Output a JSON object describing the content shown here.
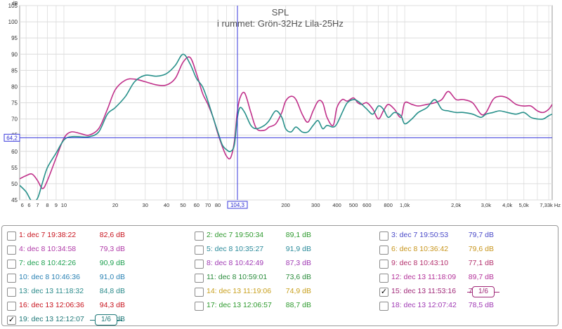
{
  "chart_data": {
    "type": "line",
    "title": "SPL",
    "subtitle": "i rummet: Grön-32Hz Lila-25Hz",
    "ylabel": "dB",
    "xscale": "log",
    "xlim": [
      5.5,
      7330
    ],
    "ylim": [
      45,
      105
    ],
    "grid": true,
    "y_ticks": [
      45,
      50,
      55,
      60,
      65,
      70,
      75,
      80,
      85,
      90,
      95,
      100,
      105
    ],
    "x_ticks": [
      {
        "v": 6,
        "label": "6"
      },
      {
        "v": 6,
        "label": "6"
      },
      {
        "v": 7,
        "label": "7"
      },
      {
        "v": 8,
        "label": "8"
      },
      {
        "v": 9,
        "label": "9"
      },
      {
        "v": 10,
        "label": "10"
      },
      {
        "v": 20,
        "label": "20"
      },
      {
        "v": 30,
        "label": "30"
      },
      {
        "v": 40,
        "label": "40"
      },
      {
        "v": 50,
        "label": "50"
      },
      {
        "v": 60,
        "label": "60"
      },
      {
        "v": 70,
        "label": "70"
      },
      {
        "v": 80,
        "label": "80"
      },
      {
        "v": 200,
        "label": "200"
      },
      {
        "v": 300,
        "label": "300"
      },
      {
        "v": 400,
        "label": "400"
      },
      {
        "v": 500,
        "label": "500"
      },
      {
        "v": 600,
        "label": "600"
      },
      {
        "v": 800,
        "label": "800"
      },
      {
        "v": 1000,
        "label": "1,0k"
      },
      {
        "v": 2000,
        "label": "2,0k"
      },
      {
        "v": 3000,
        "label": "3,0k"
      },
      {
        "v": 4000,
        "label": "4,0k"
      },
      {
        "v": 5000,
        "label": "5,0k"
      },
      {
        "v": 7330,
        "label": "7,33k Hz"
      }
    ],
    "cursor": {
      "x": 104.3,
      "x_label": "104,3",
      "y": 64.2,
      "y_label": "64,2"
    },
    "series": [
      {
        "color": "#c0308a",
        "x": [
          5.5,
          6,
          6.5,
          7,
          7.5,
          8,
          9,
          10,
          11,
          12.5,
          14,
          16,
          18,
          20,
          23,
          26,
          30,
          35,
          40,
          45,
          50,
          55,
          60,
          65,
          70,
          75,
          80,
          85,
          90,
          95,
          100,
          104,
          108,
          115,
          125,
          135,
          150,
          160,
          175,
          190,
          200,
          215,
          230,
          250,
          270,
          290,
          310,
          330,
          350,
          380,
          400,
          430,
          460,
          500,
          530,
          560,
          600,
          650,
          700,
          750,
          800,
          870,
          950,
          1000,
          1100,
          1200,
          1350,
          1500,
          1650,
          1800,
          2000,
          2200,
          2500,
          2800,
          3000,
          3300,
          3600,
          4000,
          4500,
          5000,
          5500,
          6000,
          6500,
          7000,
          7330
        ],
        "y": [
          51.5,
          52.5,
          53,
          51,
          48.5,
          51,
          58,
          64,
          66,
          65.5,
          65,
          67,
          73,
          79,
          82,
          82.3,
          81.5,
          80.5,
          80.5,
          82.5,
          87.5,
          89,
          84,
          78,
          74.5,
          70.5,
          65.5,
          61.5,
          58.5,
          58,
          63,
          72,
          76.5,
          78,
          72,
          67,
          66.5,
          67.5,
          68.5,
          72,
          75.5,
          77,
          76,
          71.5,
          69,
          72.5,
          75.5,
          75,
          70.5,
          68,
          73.5,
          76,
          75.5,
          76.5,
          75,
          74.5,
          75,
          73,
          70,
          72.5,
          74.5,
          73,
          70.5,
          75,
          74.5,
          74,
          74.5,
          75,
          76,
          78.5,
          76,
          76,
          75,
          71.5,
          72,
          76,
          77,
          76.5,
          74.5,
          74,
          74,
          72.5,
          72,
          73,
          74.5
        ]
      },
      {
        "color": "#27908a",
        "x": [
          5.5,
          6,
          6.5,
          7,
          7.5,
          8,
          9,
          10,
          11,
          12.5,
          14,
          16,
          18,
          20,
          23,
          26,
          30,
          35,
          40,
          45,
          50,
          55,
          60,
          65,
          70,
          75,
          80,
          85,
          90,
          95,
          100,
          104,
          108,
          115,
          125,
          135,
          150,
          160,
          175,
          190,
          200,
          215,
          230,
          250,
          270,
          290,
          310,
          330,
          350,
          380,
          400,
          430,
          460,
          500,
          530,
          560,
          600,
          650,
          700,
          750,
          800,
          870,
          950,
          1000,
          1100,
          1200,
          1350,
          1500,
          1650,
          1800,
          2000,
          2200,
          2500,
          2800,
          3000,
          3300,
          3600,
          4000,
          4500,
          5000,
          5500,
          6000,
          6500,
          7000,
          7330
        ],
        "y": [
          49.5,
          47.5,
          44.5,
          45.5,
          50.5,
          55,
          59.5,
          63.5,
          64.5,
          64.5,
          64.5,
          66,
          71.5,
          73.5,
          77,
          81.5,
          83.5,
          83.2,
          84,
          86.5,
          90,
          87,
          82.5,
          80,
          75.5,
          70.5,
          66,
          62,
          60.5,
          60,
          62,
          70,
          73.5,
          72,
          68,
          67,
          68,
          69.5,
          72.5,
          70.5,
          67,
          66,
          67.5,
          66,
          66,
          68,
          69.5,
          67,
          68,
          67.5,
          68.5,
          72,
          75,
          76,
          75.5,
          74.5,
          73,
          71.5,
          74,
          73,
          70.5,
          72,
          71,
          68.5,
          70,
          72,
          73.5,
          76,
          73,
          72.5,
          72,
          72,
          71.5,
          70.5,
          71.5,
          72,
          72.5,
          72,
          71.5,
          72,
          70.5,
          70,
          70,
          71,
          71.5
        ]
      }
    ]
  },
  "legend": {
    "rows": [
      [
        {
          "label": "1: dec 7 19:38:22",
          "value": "82,6 dB",
          "color": "#c8141e",
          "checked": false
        },
        {
          "label": "2: dec 7 19:50:34",
          "value": "89,1 dB",
          "color": "#2e9a2e",
          "checked": false
        },
        {
          "label": "3: dec 7 19:50:53",
          "value": "79,7 dB",
          "color": "#4a4ac8",
          "checked": false
        }
      ],
      [
        {
          "label": "4: dec 8 10:34:58",
          "value": "79,3 dB",
          "color": "#b03aa8",
          "checked": false
        },
        {
          "label": "5: dec 8 10:35:27",
          "value": "91,9 dB",
          "color": "#2a8a9a",
          "checked": false
        },
        {
          "label": "6: dec 8 10:36:42",
          "value": "79,6 dB",
          "color": "#c8961e",
          "checked": false
        }
      ],
      [
        {
          "label": "7: dec 8 10:42:26",
          "value": "90,9 dB",
          "color": "#1ea050",
          "checked": false
        },
        {
          "label": "8: dec 8 10:42:49",
          "value": "87,3 dB",
          "color": "#a03ab4",
          "checked": false
        },
        {
          "label": "9: dec 8 10:43:10",
          "value": "77,1 dB",
          "color": "#b4326e",
          "checked": false
        }
      ],
      [
        {
          "label": "10: dec 8 10:46:36",
          "value": "91,0 dB",
          "color": "#2a82b4",
          "checked": false
        },
        {
          "label": "11: dec 8 10:59:01",
          "value": "73,6 dB",
          "color": "#2a8c3c",
          "checked": false
        },
        {
          "label": "12: dec 13 11:18:09",
          "value": "89,7 dB",
          "color": "#b4329a",
          "checked": false
        }
      ],
      [
        {
          "label": "13: dec 13 11:18:32",
          "value": "84,8 dB",
          "color": "#2a8a8a",
          "checked": false
        },
        {
          "label": "14: dec 13 11:19:06",
          "value": "74,9 dB",
          "color": "#c8a01e",
          "checked": false
        },
        {
          "label": "15: dec 13 11:53:16",
          "value": "76,7 dB",
          "color": "#a02878",
          "checked": true,
          "smoothing": "1/6"
        }
      ],
      [
        {
          "label": "16: dec 13 12:06:36",
          "value": "94,3 dB",
          "color": "#c8141e",
          "checked": false
        },
        {
          "label": "17: dec 13 12:06:57",
          "value": "88,7 dB",
          "color": "#2e9a2e",
          "checked": false
        },
        {
          "label": "18: dec 13 12:07:42",
          "value": "78,5 dB",
          "color": "#a03ab4",
          "checked": false
        }
      ],
      [
        {
          "label": "19: dec 13 12:12:07",
          "value": "72,7 dB",
          "color": "#1e7878",
          "checked": true,
          "smoothing": "1/6"
        }
      ]
    ],
    "check_mark": "✓"
  }
}
